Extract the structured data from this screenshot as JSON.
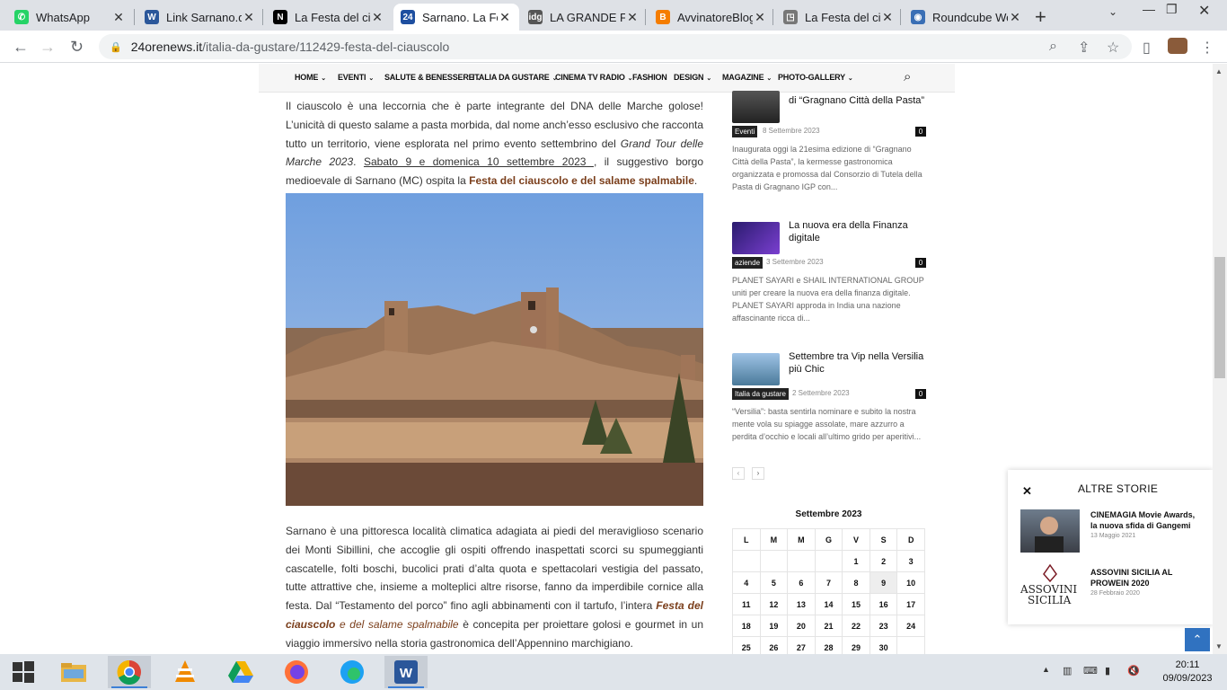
{
  "browser": {
    "tabs": [
      {
        "title": "WhatsApp",
        "icon": "whatsapp-icon",
        "color": "#25d366",
        "glyph": "✆"
      },
      {
        "title": "Link Sarnano.d",
        "icon": "word-icon",
        "color": "#2b579a",
        "glyph": "W"
      },
      {
        "title": "La Festa del cia",
        "icon": "notion-icon",
        "color": "#000000",
        "glyph": "N"
      },
      {
        "title": "Sarnano. La Fe",
        "icon": "site-24ore-icon",
        "color": "#1e4fa0",
        "glyph": "24"
      },
      {
        "title": "LA GRANDE FE",
        "icon": "idg-icon",
        "color": "#555555",
        "glyph": "idg"
      },
      {
        "title": "AvvinatoreBlog",
        "icon": "blogger-icon",
        "color": "#f57d00",
        "glyph": "B"
      },
      {
        "title": "La Festa del cia",
        "icon": "doc-icon",
        "color": "#777777",
        "glyph": "◳"
      },
      {
        "title": "Roundcube We",
        "icon": "roundcube-icon",
        "color": "#3a6fb5",
        "glyph": "◉"
      }
    ],
    "url_domain": "24orenews.it",
    "url_path": "/italia-da-gustare/112429-festa-del-ciauscolo"
  },
  "menu": [
    {
      "label": "HOME",
      "caret": true
    },
    {
      "label": "EVENTI",
      "caret": true
    },
    {
      "label": "SALUTE & BENESSERE",
      "caret": true
    },
    {
      "label": "ITALIA DA GUSTARE",
      "caret": true
    },
    {
      "label": "CINEMA TV RADIO",
      "caret": true
    },
    {
      "label": "FASHION",
      "caret": false
    },
    {
      "label": "DESIGN",
      "caret": true
    },
    {
      "label": "MAGAZINE",
      "caret": true
    },
    {
      "label": "PHOTO-GALLERY",
      "caret": true
    }
  ],
  "article": {
    "p1_a": "Il ciauscolo è una leccornia che è parte integrante del DNA delle Marche golose! L’unicità di questo salame a pasta morbida, dal nome anch’esso esclusivo che racconta tutto un territorio, viene esplorata nel primo evento settembrino del ",
    "p1_italic": "Grand Tour delle Marche 2023",
    "p1_b": ".  ",
    "p1_link": "Sabato 9 e domenica 10 settembre 2023 ",
    "p1_c": ", il suggestivo borgo medioevale di Sarnano (MC) ospita la ",
    "p1_bold": "Festa del ciauscolo e del salame spalmabile",
    "p1_end": ".",
    "p2_a": "Sarnano è una pittoresca località climatica adagiata ai piedi del meraviglioso scenario dei Monti Sibillini, che accoglie gli ospiti offrendo inaspettati scorci su spumeggianti cascatelle, folti boschi, bucolici prati d’alta quota e spettacolari vestigia del passato, tutte attrattive che, insieme a molteplici altre risorse, fanno da imperdibile cornice alla festa. Dal “Testamento del porco” fino agli abbinamenti con il tartufo, l’intera ",
    "p2_bold_italic": "Festa del ciauscolo",
    "p2_italic": " e del salame spalmabile",
    "p2_b": " è concepita per proiettare golosi e gourmet in un viaggio immersivo nella storia gastronomica dell’Appennino marchigiano."
  },
  "sidebar": {
    "posts": [
      {
        "title": "di “Gragnano Città della Pasta”",
        "category": "Eventi",
        "date": "8 Settembre 2023",
        "comments": "0",
        "excerpt": "Inaugurata oggi la 21esima edizione di “Gragnano Città della Pasta”, la kermesse gastronomica organizzata e promossa dal Consorzio di Tutela della Pasta di Gragnano IGP con..."
      },
      {
        "title": "La nuova era della Finanza digitale",
        "category": "aziende",
        "date": "3 Settembre 2023",
        "comments": "0",
        "excerpt": "PLANET SAYARI e SHAIL INTERNATIONAL GROUP uniti per creare la nuova era della finanza digitale. PLANET SAYARI approda in India una nazione affascinante ricca di..."
      },
      {
        "title": "Settembre tra Vip nella Versilia più Chic",
        "category": "Italia da gustare",
        "date": "2 Settembre 2023",
        "comments": "0",
        "excerpt": "“Versilia”: basta sentirla nominare e subito la nostra mente vola su spiagge assolate, mare azzurro a perdita d’occhio e locali all’ultimo grido per aperitivi..."
      }
    ],
    "pager_prev": "‹",
    "pager_next": "›"
  },
  "calendar": {
    "title": "Settembre 2023",
    "days": [
      "L",
      "M",
      "M",
      "G",
      "V",
      "S",
      "D"
    ],
    "weeks": [
      [
        "",
        "",
        "",
        "",
        "1",
        "2",
        "3"
      ],
      [
        "4",
        "5",
        "6",
        "7",
        "8",
        "9",
        "10"
      ],
      [
        "11",
        "12",
        "13",
        "14",
        "15",
        "16",
        "17"
      ],
      [
        "18",
        "19",
        "20",
        "21",
        "22",
        "23",
        "24"
      ],
      [
        "25",
        "26",
        "27",
        "28",
        "29",
        "30",
        ""
      ]
    ],
    "today": "9"
  },
  "altre_storie": {
    "heading": "ALTRE STORIE",
    "close": "✕",
    "items": [
      {
        "title": "CINEMAGIA Movie Awards, la nuova sfida di Gangemi",
        "date": "13 Maggio 2021"
      },
      {
        "title": "ASSOVINI SICILIA AL PROWEIN 2020",
        "date": "28 Febbraio 2020"
      }
    ],
    "logo_text_1": "ASSOVINI",
    "logo_text_2": "SICILIA"
  },
  "taskbar": {
    "time": "20:11",
    "date": "09/09/2023"
  }
}
